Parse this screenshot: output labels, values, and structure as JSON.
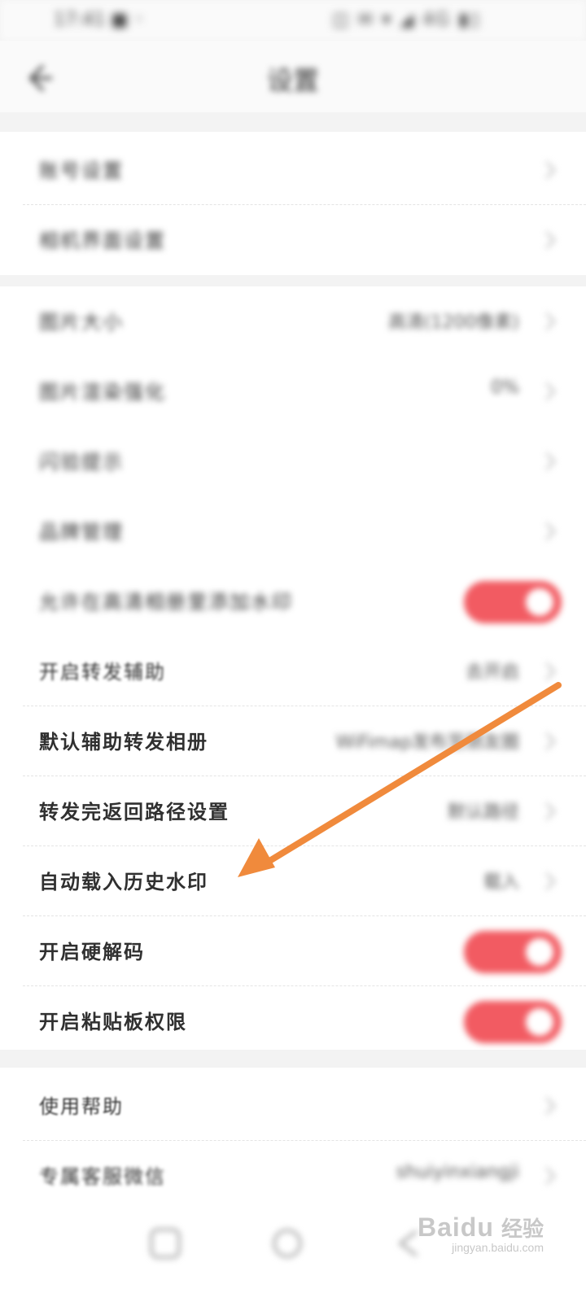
{
  "status_bar": {
    "time": "17:41 ■ ◦",
    "icons": "◫ ✉ ▾ ◢ 4G ▮▯"
  },
  "header": {
    "title": "设置"
  },
  "section_one": [
    {
      "label": "账号设置"
    },
    {
      "label": "相机界面设置"
    }
  ],
  "section_two": [
    {
      "label": "图片大小",
      "value": "高清(1200像素)",
      "control": "chevron"
    },
    {
      "label": "图片渲染强化",
      "value": "0%",
      "control": "chevron"
    },
    {
      "label": "闪验提示",
      "value": "",
      "control": "chevron"
    },
    {
      "label": "品牌管理",
      "value": "",
      "control": "chevron"
    },
    {
      "label": "允许在高清相册里添加水印",
      "value": "",
      "control": "toggle",
      "on": true
    },
    {
      "label": "开启转发辅助",
      "value": "去开启",
      "control": "chevron"
    },
    {
      "label": "默认辅助转发相册",
      "value": "WiFimap发布至朋友圈",
      "control": "chevron"
    },
    {
      "label": "转发完返回路径设置",
      "value": "默认路径",
      "control": "chevron"
    },
    {
      "label": "自动载入历史水印",
      "value": "载入",
      "control": "chevron"
    },
    {
      "label": "开启硬解码",
      "value": "",
      "control": "toggle",
      "on": true
    },
    {
      "label": "开启粘贴板权限",
      "value": "",
      "control": "toggle",
      "on": true
    }
  ],
  "section_three": [
    {
      "label": "使用帮助",
      "value": ""
    },
    {
      "label": "专属客服微信",
      "value": "shuiyinxiangji"
    }
  ],
  "bottom_bar": {
    "icons": [
      "camera-icon",
      "home-icon",
      "back-nav-icon"
    ]
  },
  "watermark": {
    "logo": "Baidu",
    "jingyan": "经验",
    "url": "jingyan.baidu.com"
  },
  "annotation": {
    "arrow_color": "#f08a3c"
  },
  "colors": {
    "toggle_on": "#f25b62",
    "background": "#f3f3f3",
    "card": "#ffffff"
  }
}
